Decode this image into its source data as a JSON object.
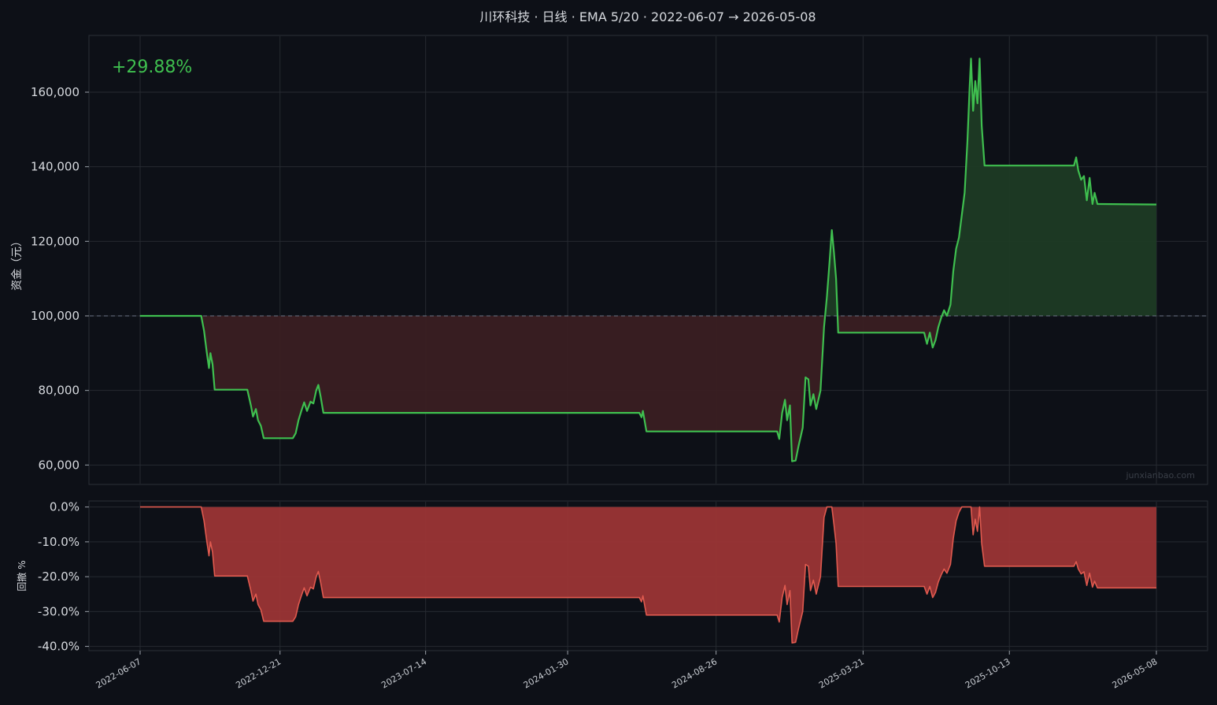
{
  "title": "川环科技 · 日线 · EMA 5/20 · 2022-06-07 → 2026-05-08",
  "watermark": "junxianbao.com",
  "return_label": "+29.88%",
  "colors": {
    "background": "#0d1017",
    "equity_line": "#3fbf4f",
    "gain_fill": "#1d3b24",
    "loss_fill": "#3a1f22",
    "drawdown_line": "#e05a4f",
    "drawdown_fill": "#9b3535",
    "grid": "#262a31",
    "baseline": "#6b7585"
  },
  "chart_data": [
    {
      "type": "line",
      "title": "川环科技 · 日线 · EMA 5/20 · 2022-06-07 → 2026-05-08",
      "ylabel": "资金（元）",
      "baseline": 100000,
      "ylim": [
        55000,
        175000
      ],
      "yticks": [
        60000,
        80000,
        100000,
        120000,
        140000,
        160000
      ],
      "ytick_labels": [
        "60,000",
        "80,000",
        "100,000",
        "120,000",
        "140,000",
        "160,000"
      ],
      "grid": true,
      "annotation": "+29.88%",
      "series": [
        {
          "points": [
            [
              "2022-06-07",
              100000
            ],
            [
              "2022-07-15",
              100000
            ],
            [
              "2022-09-01",
              100000
            ],
            [
              "2022-09-05",
              96000
            ],
            [
              "2022-09-09",
              90000
            ],
            [
              "2022-09-12",
              86000
            ],
            [
              "2022-09-14",
              90000
            ],
            [
              "2022-09-17",
              87000
            ],
            [
              "2022-09-20",
              80200
            ],
            [
              "2022-11-05",
              80200
            ],
            [
              "2022-11-10",
              76000
            ],
            [
              "2022-11-13",
              73000
            ],
            [
              "2022-11-17",
              75000
            ],
            [
              "2022-11-20",
              72000
            ],
            [
              "2022-11-24",
              70500
            ],
            [
              "2022-11-28",
              67200
            ],
            [
              "2023-01-08",
              67200
            ],
            [
              "2023-01-12",
              68500
            ],
            [
              "2023-01-16",
              72000
            ],
            [
              "2023-01-20",
              74500
            ],
            [
              "2023-01-24",
              76800
            ],
            [
              "2023-01-28",
              74500
            ],
            [
              "2023-02-02",
              77000
            ],
            [
              "2023-02-06",
              76500
            ],
            [
              "2023-02-10",
              80000
            ],
            [
              "2023-02-13",
              81500
            ],
            [
              "2023-02-16",
              78500
            ],
            [
              "2023-02-20",
              74000
            ],
            [
              "2024-05-10",
              74000
            ],
            [
              "2024-05-13",
              72800
            ],
            [
              "2024-05-15",
              74500
            ],
            [
              "2024-05-20",
              69000
            ],
            [
              "2024-11-20",
              69000
            ],
            [
              "2024-11-23",
              67000
            ],
            [
              "2024-11-27",
              74000
            ],
            [
              "2024-12-01",
              77500
            ],
            [
              "2024-12-04",
              72000
            ],
            [
              "2024-12-08",
              76000
            ],
            [
              "2024-12-11",
              61000
            ],
            [
              "2024-12-16",
              61200
            ],
            [
              "2024-12-20",
              65000
            ],
            [
              "2024-12-26",
              70000
            ],
            [
              "2024-12-30",
              83500
            ],
            [
              "2025-01-03",
              83000
            ],
            [
              "2025-01-06",
              76000
            ],
            [
              "2025-01-10",
              79000
            ],
            [
              "2025-01-14",
              75000
            ],
            [
              "2025-01-20",
              80000
            ],
            [
              "2025-01-25",
              97000
            ],
            [
              "2025-01-29",
              105000
            ],
            [
              "2025-02-02",
              115000
            ],
            [
              "2025-02-05",
              123000
            ],
            [
              "2025-02-08",
              117000
            ],
            [
              "2025-02-11",
              110000
            ],
            [
              "2025-02-14",
              95500
            ],
            [
              "2025-06-15",
              95500
            ],
            [
              "2025-06-19",
              92500
            ],
            [
              "2025-06-23",
              95500
            ],
            [
              "2025-06-27",
              91500
            ],
            [
              "2025-07-01",
              93500
            ],
            [
              "2025-07-05",
              97000
            ],
            [
              "2025-07-09",
              99500
            ],
            [
              "2025-07-13",
              101500
            ],
            [
              "2025-07-17",
              100000
            ],
            [
              "2025-07-22",
              103000
            ],
            [
              "2025-07-26",
              112000
            ],
            [
              "2025-07-30",
              118000
            ],
            [
              "2025-08-03",
              121000
            ],
            [
              "2025-08-07",
              127000
            ],
            [
              "2025-08-11",
              133000
            ],
            [
              "2025-08-15",
              147000
            ],
            [
              "2025-08-18",
              161000
            ],
            [
              "2025-08-20",
              169000
            ],
            [
              "2025-08-23",
              155000
            ],
            [
              "2025-08-26",
              163000
            ],
            [
              "2025-08-29",
              157000
            ],
            [
              "2025-09-01",
              169000
            ],
            [
              "2025-09-04",
              151000
            ],
            [
              "2025-09-08",
              140300
            ],
            [
              "2026-01-12",
              140300
            ],
            [
              "2026-01-15",
              142500
            ],
            [
              "2026-01-18",
              139000
            ],
            [
              "2026-01-22",
              136500
            ],
            [
              "2026-01-26",
              137500
            ],
            [
              "2026-01-30",
              131000
            ],
            [
              "2026-02-03",
              137000
            ],
            [
              "2026-02-07",
              130000
            ],
            [
              "2026-02-10",
              133000
            ],
            [
              "2026-02-14",
              130000
            ],
            [
              "2026-05-08",
              129880
            ]
          ]
        }
      ]
    },
    {
      "type": "area",
      "ylabel": "回撤 %",
      "ylim": [
        -41,
        1.5
      ],
      "yticks": [
        0,
        -10,
        -20,
        -30,
        -40
      ],
      "ytick_labels": [
        "0.0%",
        "-10.0%",
        "-20.0%",
        "-30.0%",
        "-40.0%"
      ],
      "grid": true,
      "series": [
        {
          "points": [
            [
              "2022-06-07",
              0
            ],
            [
              "2022-09-01",
              0
            ],
            [
              "2022-09-05",
              -4
            ],
            [
              "2022-09-09",
              -10
            ],
            [
              "2022-09-12",
              -14
            ],
            [
              "2022-09-14",
              -10
            ],
            [
              "2022-09-17",
              -13
            ],
            [
              "2022-09-20",
              -19.8
            ],
            [
              "2022-11-05",
              -19.8
            ],
            [
              "2022-11-10",
              -24
            ],
            [
              "2022-11-13",
              -27
            ],
            [
              "2022-11-17",
              -25
            ],
            [
              "2022-11-20",
              -28
            ],
            [
              "2022-11-24",
              -29.5
            ],
            [
              "2022-11-28",
              -32.8
            ],
            [
              "2023-01-08",
              -32.8
            ],
            [
              "2023-01-12",
              -31.5
            ],
            [
              "2023-01-16",
              -28
            ],
            [
              "2023-01-20",
              -25.5
            ],
            [
              "2023-01-24",
              -23.2
            ],
            [
              "2023-01-28",
              -25.5
            ],
            [
              "2023-02-02",
              -23
            ],
            [
              "2023-02-06",
              -23.5
            ],
            [
              "2023-02-10",
              -20
            ],
            [
              "2023-02-13",
              -18.5
            ],
            [
              "2023-02-16",
              -21.5
            ],
            [
              "2023-02-20",
              -26
            ],
            [
              "2024-05-10",
              -26
            ],
            [
              "2024-05-13",
              -27.2
            ],
            [
              "2024-05-15",
              -25.5
            ],
            [
              "2024-05-20",
              -31
            ],
            [
              "2024-11-20",
              -31
            ],
            [
              "2024-11-23",
              -33
            ],
            [
              "2024-11-27",
              -26
            ],
            [
              "2024-12-01",
              -22.5
            ],
            [
              "2024-12-04",
              -28
            ],
            [
              "2024-12-08",
              -24
            ],
            [
              "2024-12-11",
              -39
            ],
            [
              "2024-12-16",
              -38.8
            ],
            [
              "2024-12-20",
              -35
            ],
            [
              "2024-12-26",
              -30
            ],
            [
              "2024-12-30",
              -16.5
            ],
            [
              "2025-01-03",
              -17
            ],
            [
              "2025-01-06",
              -24
            ],
            [
              "2025-01-10",
              -21
            ],
            [
              "2025-01-14",
              -25
            ],
            [
              "2025-01-20",
              -20
            ],
            [
              "2025-01-25",
              -3
            ],
            [
              "2025-01-29",
              0
            ],
            [
              "2025-02-02",
              0
            ],
            [
              "2025-02-05",
              0
            ],
            [
              "2025-02-08",
              -5
            ],
            [
              "2025-02-11",
              -10.5
            ],
            [
              "2025-02-14",
              -22.8
            ],
            [
              "2025-06-15",
              -22.8
            ],
            [
              "2025-06-19",
              -25
            ],
            [
              "2025-06-23",
              -22.8
            ],
            [
              "2025-06-27",
              -26
            ],
            [
              "2025-07-01",
              -24.5
            ],
            [
              "2025-07-05",
              -21.5
            ],
            [
              "2025-07-09",
              -19.5
            ],
            [
              "2025-07-13",
              -17.8
            ],
            [
              "2025-07-17",
              -19
            ],
            [
              "2025-07-22",
              -16.5
            ],
            [
              "2025-07-26",
              -9
            ],
            [
              "2025-07-30",
              -4
            ],
            [
              "2025-08-03",
              -1.5
            ],
            [
              "2025-08-07",
              0
            ],
            [
              "2025-08-11",
              0
            ],
            [
              "2025-08-15",
              0
            ],
            [
              "2025-08-18",
              0
            ],
            [
              "2025-08-20",
              0
            ],
            [
              "2025-08-23",
              -8
            ],
            [
              "2025-08-26",
              -3.5
            ],
            [
              "2025-08-29",
              -7
            ],
            [
              "2025-09-01",
              0
            ],
            [
              "2025-09-04",
              -10.5
            ],
            [
              "2025-09-08",
              -17
            ],
            [
              "2026-01-12",
              -17
            ],
            [
              "2026-01-15",
              -15.7
            ],
            [
              "2026-01-18",
              -17.8
            ],
            [
              "2026-01-22",
              -19.2
            ],
            [
              "2026-01-26",
              -18.6
            ],
            [
              "2026-01-30",
              -22.5
            ],
            [
              "2026-02-03",
              -19
            ],
            [
              "2026-02-07",
              -23
            ],
            [
              "2026-02-10",
              -21.3
            ],
            [
              "2026-02-14",
              -23.2
            ],
            [
              "2026-05-08",
              -23.2
            ]
          ]
        }
      ]
    }
  ],
  "x_axis": {
    "range": [
      "2022-06-07",
      "2026-05-08"
    ],
    "ticks": [
      "2022-06-07",
      "2022-12-21",
      "2023-07-14",
      "2024-01-30",
      "2024-08-26",
      "2025-03-21",
      "2025-10-13",
      "2026-05-08"
    ]
  }
}
